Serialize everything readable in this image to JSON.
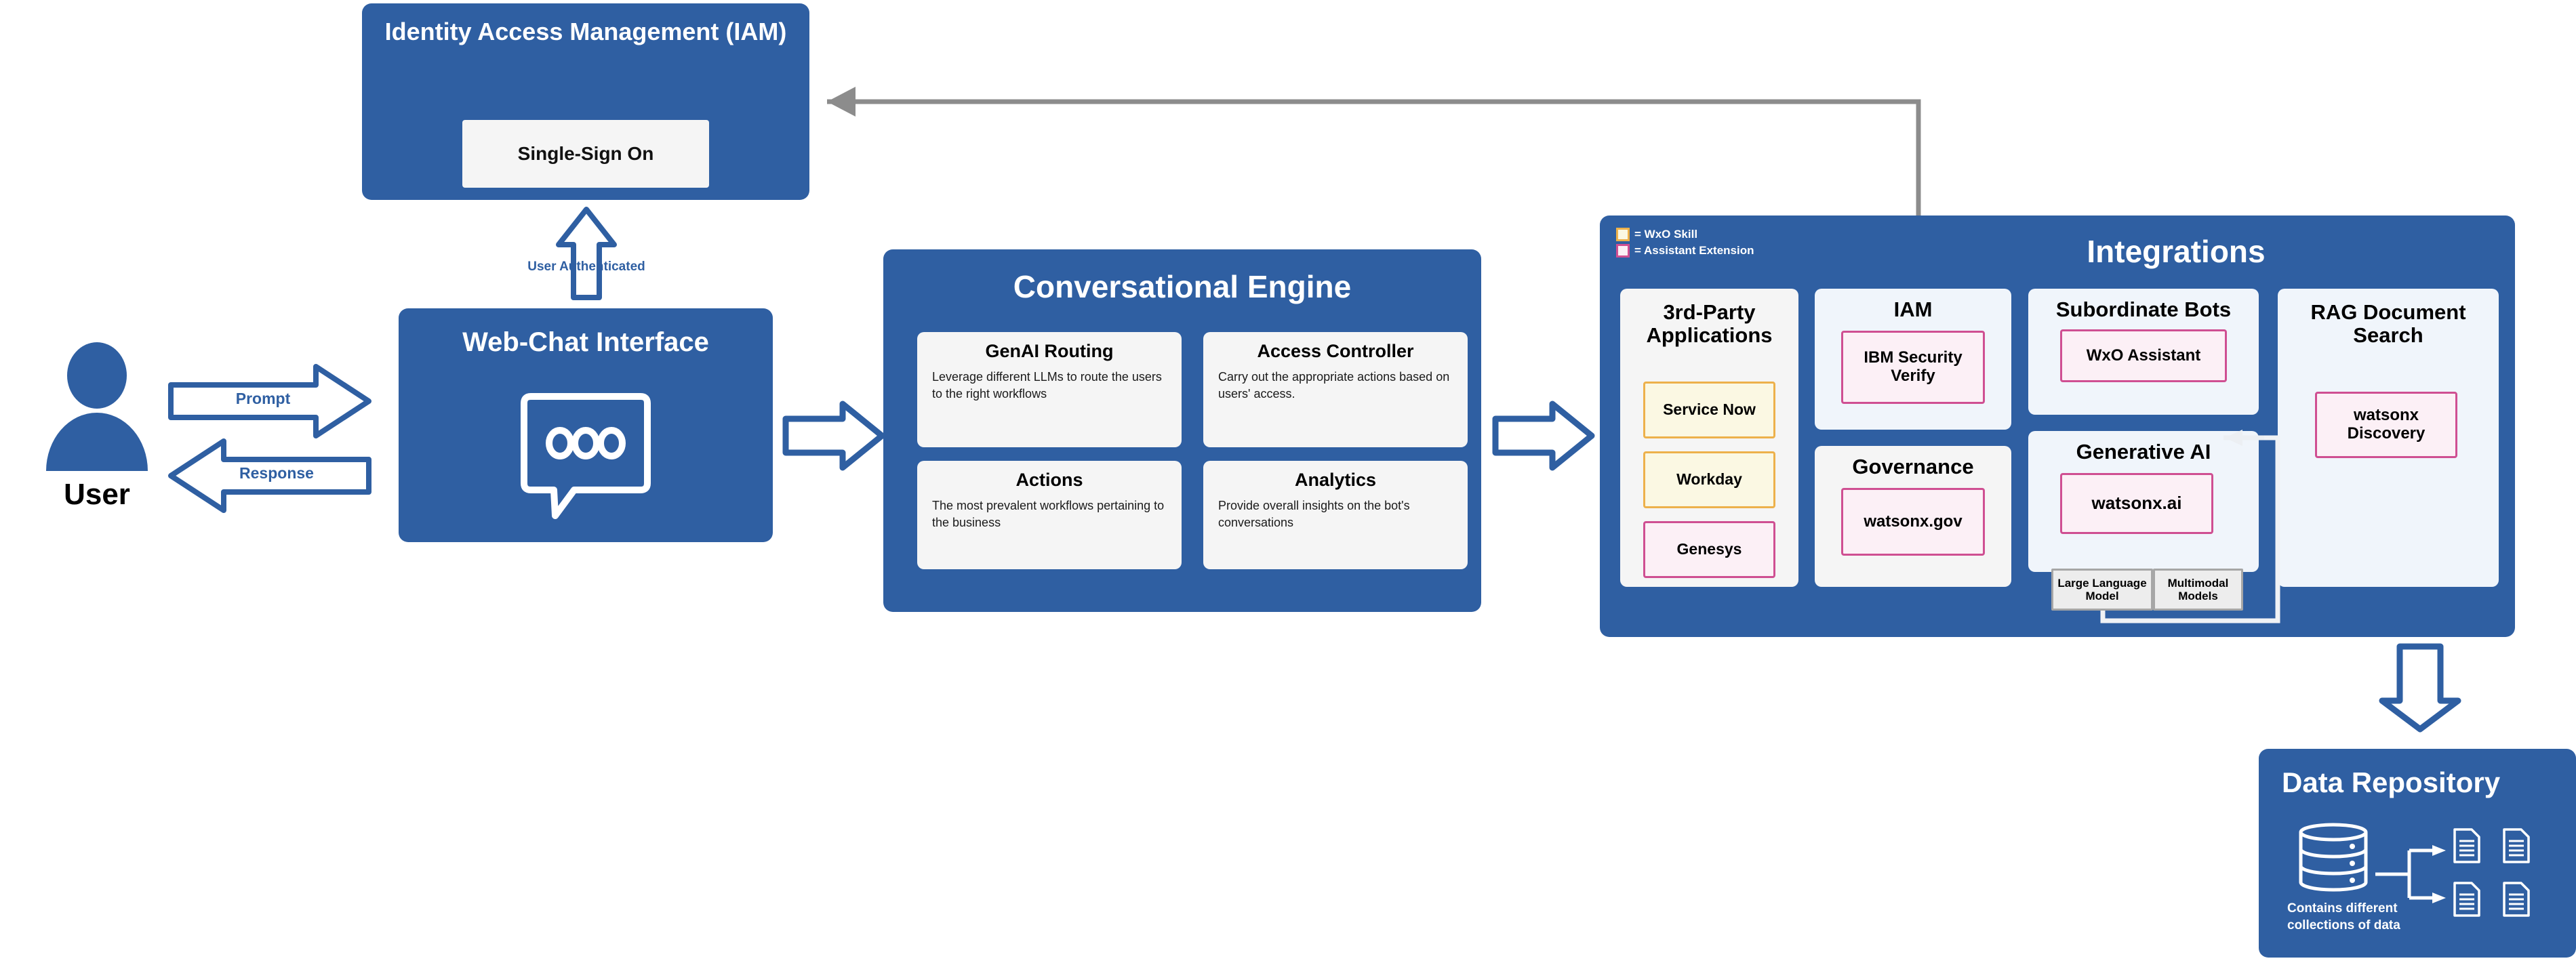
{
  "iam_box": {
    "title": "Identity Access Management (IAM)",
    "sso_label": "Single-Sign On"
  },
  "auth_arrow": {
    "label": "User Authenticated",
    "icon": "arrow-up-icon"
  },
  "user": {
    "label": "User",
    "icon": "user-avatar-icon",
    "prompt_label": "Prompt",
    "response_label": "Response"
  },
  "webchat": {
    "title": "Web-Chat Interface",
    "icon": "chat-bubble-icon"
  },
  "conversational_engine": {
    "title": "Conversational Engine",
    "cards": [
      {
        "title": "GenAI Routing",
        "body": "Leverage different LLMs to route the users to the right workflows"
      },
      {
        "title": "Access Controller",
        "body": "Carry out the appropriate actions based on users' access."
      },
      {
        "title": "Actions",
        "body": "The most prevalent workflows pertaining to the business"
      },
      {
        "title": "Analytics",
        "body": "Provide overall insights on the bot's conversations"
      }
    ]
  },
  "integrations": {
    "title": "Integrations",
    "legend": [
      {
        "label": "= WxO Skill",
        "type": "skill"
      },
      {
        "label": "= Assistant Extension",
        "type": "extension"
      }
    ],
    "third_party": {
      "title": "3rd-Party Applications",
      "chips": [
        {
          "label": "Service Now",
          "type": "skill"
        },
        {
          "label": "Workday",
          "type": "skill"
        },
        {
          "label": "Genesys",
          "type": "extension"
        }
      ]
    },
    "iam": {
      "title": "IAM",
      "chips": [
        {
          "label": "IBM Security Verify",
          "type": "extension"
        }
      ]
    },
    "governance": {
      "title": "Governance",
      "chips": [
        {
          "label": "watsonx.gov",
          "type": "extension"
        }
      ]
    },
    "subordinate_bots": {
      "title": "Subordinate Bots",
      "chips": [
        {
          "label": "WxO Assistant",
          "type": "extension"
        }
      ]
    },
    "generative_ai": {
      "title": "Generative AI",
      "chips": [
        {
          "label": "watsonx.ai",
          "type": "extension"
        }
      ],
      "sub_boxes": [
        {
          "label": "Large Language Model"
        },
        {
          "label": "Multimodal Models"
        }
      ]
    },
    "rag": {
      "title": "RAG Document Search",
      "chips": [
        {
          "label": "watsonx Discovery",
          "type": "extension"
        }
      ]
    }
  },
  "data_repository": {
    "title": "Data Repository",
    "caption": "Contains different collections of data",
    "icons": [
      "database-icon",
      "document-icon",
      "document-icon",
      "document-icon",
      "document-icon"
    ]
  },
  "colors": {
    "panel_blue": "#2f5fa2",
    "skill_border": "#edb14b",
    "skill_fill": "#fbf8e3",
    "extension_border": "#cf4f92",
    "extension_fill": "#fcf0f6",
    "connector_gray": "#8c8c8c",
    "card_white": "#f5f5f5"
  }
}
